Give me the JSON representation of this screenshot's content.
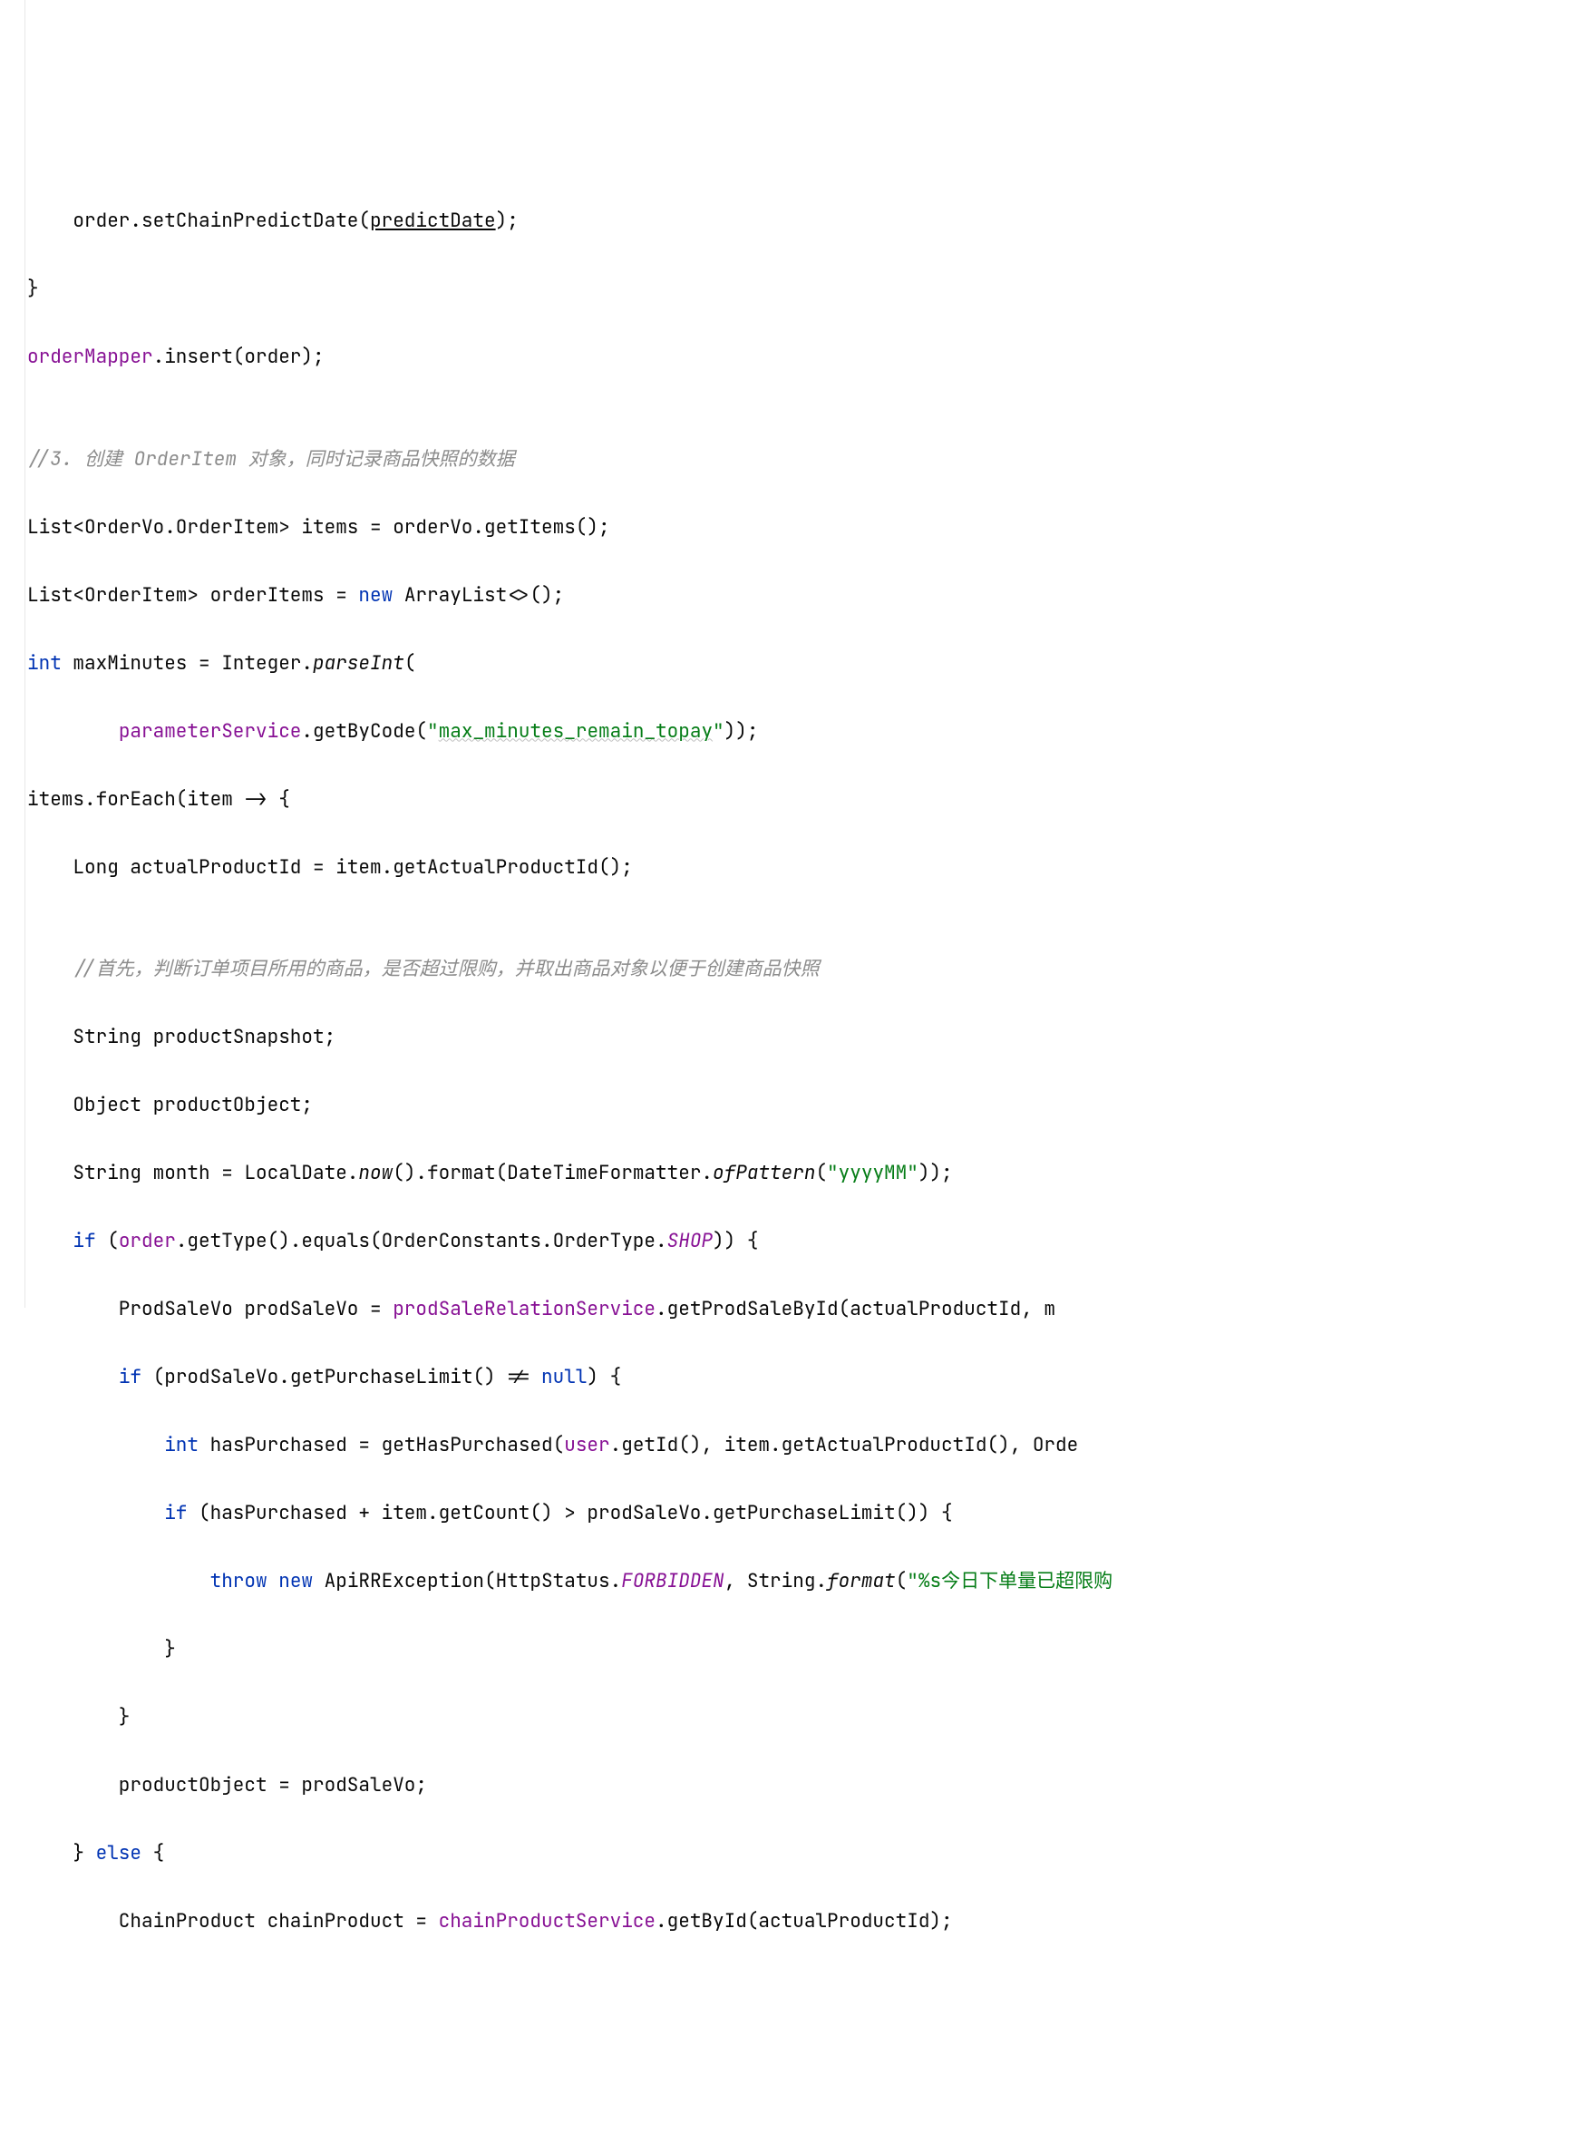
{
  "code": {
    "l1_a": "    order.setChainPredictDate(",
    "l1_b": "predictDate",
    "l1_c": ");",
    "l2": "}",
    "l3_a": "orderMapper",
    "l3_b": ".insert(order);",
    "l4": "",
    "l5_a": "//3. 创建 OrderItem 对象，同时记录商品快照的数据",
    "l6": "List<OrderVo.OrderItem> items = orderVo.getItems();",
    "l7_a": "List<OrderItem> orderItems = ",
    "l7_b": "new",
    "l7_c": " ArrayList<>();",
    "l8_a": "int",
    "l8_b": " maxMinutes = Integer.",
    "l8_c": "parseInt",
    "l8_d": "(",
    "l9_a": "        ",
    "l9_b": "parameterService",
    "l9_c": ".getByCode(",
    "l9_d": "\"",
    "l9_e": "max_minutes_remain_topay",
    "l9_f": "\"",
    "l9_g": "));",
    "l10": "items.forEach(item -> {",
    "l11": "    Long actualProductId = item.getActualProductId();",
    "l12": "",
    "l13": "    //首先，判断订单项目所用的商品，是否超过限购，并取出商品对象以便于创建商品快照",
    "l14": "    String productSnapshot;",
    "l15": "    Object productObject;",
    "l16_a": "    String month = LocalDate.",
    "l16_b": "now",
    "l16_c": "().format(DateTimeFormatter.",
    "l16_d": "ofPattern",
    "l16_e": "(",
    "l16_f": "\"yyyyMM\"",
    "l16_g": "));",
    "l17_a": "    ",
    "l17_b": "if",
    "l17_c": " (",
    "l17_d": "order",
    "l17_e": ".getType().equals(OrderConstants.OrderType.",
    "l17_f": "SHOP",
    "l17_g": ")) {",
    "l18_a": "        ProdSaleVo prodSaleVo = ",
    "l18_b": "prodSaleRelationService",
    "l18_c": ".getProdSaleById(actualProductId, m",
    "l19_a": "        ",
    "l19_b": "if",
    "l19_c": " (prodSaleVo.getPurchaseLimit() != ",
    "l19_d": "null",
    "l19_e": ") {",
    "l20_a": "            ",
    "l20_b": "int",
    "l20_c": " hasPurchased = getHasPurchased(",
    "l20_d": "user",
    "l20_e": ".getId(), item.getActualProductId(), Orde",
    "l21_a": "            ",
    "l21_b": "if",
    "l21_c": " (hasPurchased + item.getCount() > prodSaleVo.getPurchaseLimit()) {",
    "l22_a": "                ",
    "l22_b": "throw",
    "l22_c": " ",
    "l22_d": "new",
    "l22_e": " ApiRRException(HttpStatus.",
    "l22_f": "FORBIDDEN",
    "l22_g": ", String.",
    "l22_h": "format",
    "l22_i": "(",
    "l22_j": "\"%s今日下单量已超限购",
    "l23": "            }",
    "l24": "        }",
    "l25": "        productObject = prodSaleVo;",
    "l26_a": "    } ",
    "l26_b": "else",
    "l26_c": " {",
    "l27_a": "        ChainProduct chainProduct = ",
    "l27_b": "chainProductService",
    "l27_c": ".getById(actualProductId);"
  }
}
